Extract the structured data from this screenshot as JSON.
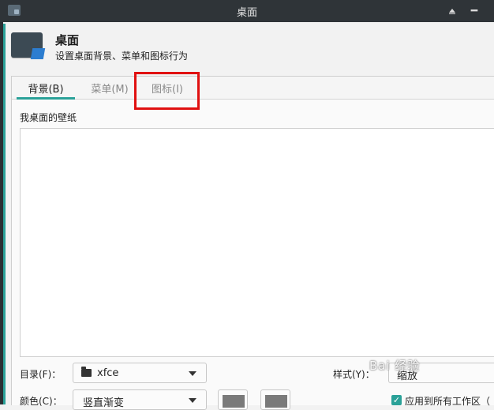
{
  "window": {
    "title": "桌面"
  },
  "header": {
    "title": "桌面",
    "subtitle": "设置桌面背景、菜单和图标行为"
  },
  "tabs": [
    {
      "label": "背景(B)",
      "active": true
    },
    {
      "label": "菜单(M)",
      "active": false
    },
    {
      "label": "图标(I)",
      "active": false
    }
  ],
  "wallpaper": {
    "section_label": "我桌面的壁纸"
  },
  "folder": {
    "label": "目录(F)：",
    "value": "xfce"
  },
  "style": {
    "label": "样式(Y)：",
    "value": "缩放"
  },
  "color": {
    "label": "颜色(C)：",
    "value": "竖直渐变"
  },
  "apply_all": {
    "label": "应用到所有工作区（",
    "checked": true
  },
  "watermark": {
    "text": "Bai 经验"
  },
  "colors": {
    "accent": "#2aa198",
    "titlebar": "#2f3438",
    "highlight": "#e01010"
  }
}
